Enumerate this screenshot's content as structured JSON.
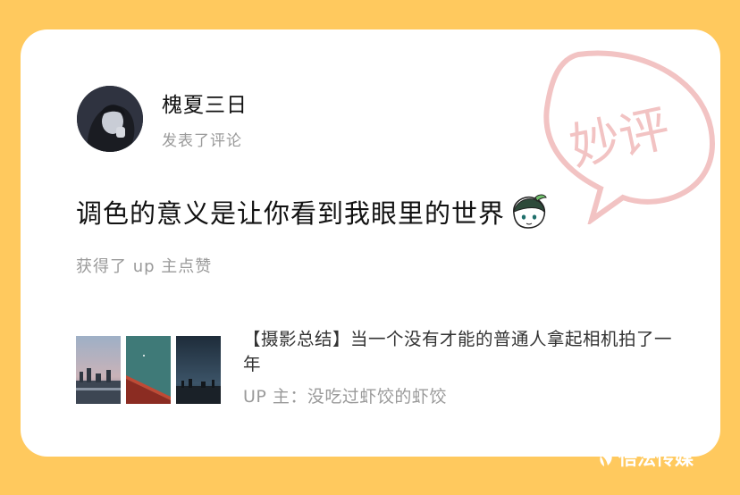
{
  "comment_card": {
    "stamp_text": "妙评",
    "user": {
      "name": "槐夏三日",
      "action": "发表了评论"
    },
    "comment_text": "调色的意义是让你看到我眼里的世界",
    "sticker_icon": "anime-character-sticker-icon",
    "liked_text": "获得了 up 主点赞",
    "video": {
      "title": "【摄影总结】当一个没有才能的普通人拿起相机拍了一年",
      "up_label": "UP 主：没吃过虾饺的虾饺"
    }
  },
  "watermark": {
    "text": "悟法传媒",
    "icon": "leaf-logo-icon"
  },
  "colors": {
    "background": "#FFC95E",
    "card": "#FFFFFF",
    "stamp": "#F2C3C3",
    "primary_text": "#111111",
    "secondary_text": "#9A9A9A"
  }
}
